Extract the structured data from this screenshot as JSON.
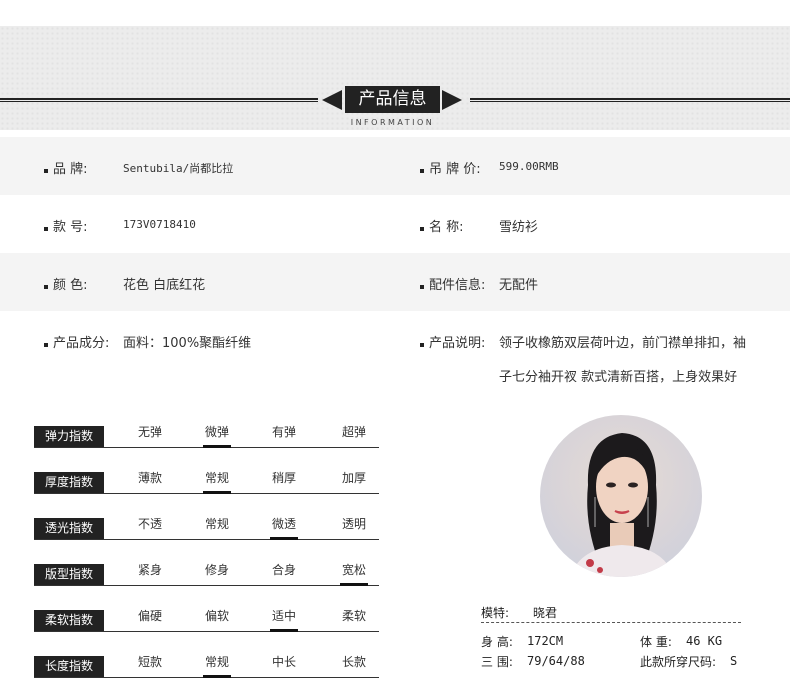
{
  "header": {
    "title": "产品信息",
    "subtitle": "INFORMATION"
  },
  "info": {
    "brand_label": "品    牌:",
    "brand_value": "Sentubila/尚都比拉",
    "price_label": "吊 牌 价:",
    "price_value": "599.00RMB",
    "style_label": "款    号:",
    "style_value": "173V0718410",
    "name_label": "名    称:",
    "name_value": "雪纺衫",
    "color_label": "颜    色:",
    "color_value": "花色 白底红花",
    "accessory_label": "配件信息:",
    "accessory_value": "无配件",
    "composition_label": "产品成分:",
    "composition_value": "面料：100%聚酯纤维",
    "desc_label": "产品说明:",
    "desc_line1": "领子收橡筋双层荷叶边，前门襟单排扣，袖",
    "desc_line2": "子七分袖开衩 款式清新百搭，上身效果好"
  },
  "indices": [
    {
      "label": "弹力指数",
      "options": [
        "无弹",
        "微弹",
        "有弹",
        "超弹"
      ],
      "selected": 1
    },
    {
      "label": "厚度指数",
      "options": [
        "薄款",
        "常规",
        "稍厚",
        "加厚"
      ],
      "selected": 1
    },
    {
      "label": "透光指数",
      "options": [
        "不透",
        "常规",
        "微透",
        "透明"
      ],
      "selected": 2
    },
    {
      "label": "版型指数",
      "options": [
        "紧身",
        "修身",
        "合身",
        "宽松"
      ],
      "selected": 3
    },
    {
      "label": "柔软指数",
      "options": [
        "偏硬",
        "偏软",
        "适中",
        "柔软"
      ],
      "selected": 2
    },
    {
      "label": "长度指数",
      "options": [
        "短款",
        "常规",
        "中长",
        "长款"
      ],
      "selected": 1
    }
  ],
  "model": {
    "name_label": "模特:",
    "name_value": "晓君",
    "height_label": "身 高:",
    "height_value": "172CM",
    "weight_label": "体 重:",
    "weight_value": "46 KG",
    "measure_label": "三 围:",
    "measure_value": "79/64/88",
    "size_label": "此款所穿尺码:",
    "size_value": "S"
  }
}
